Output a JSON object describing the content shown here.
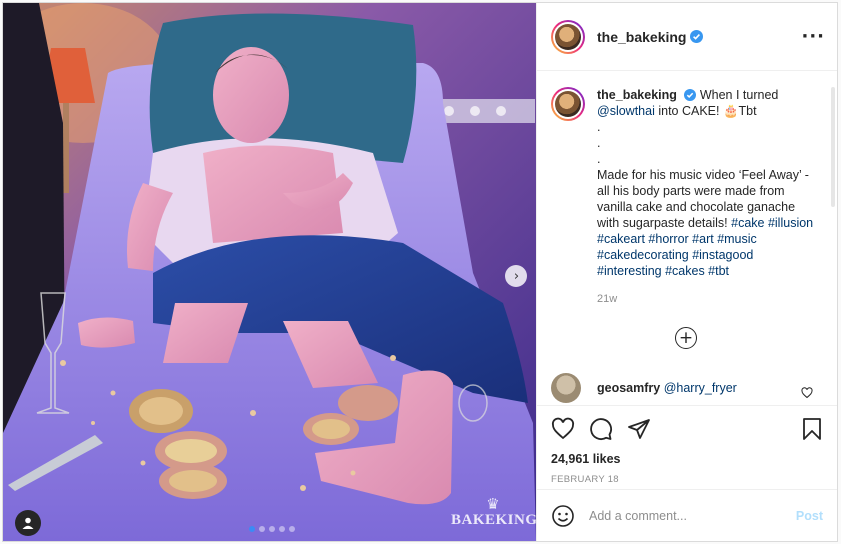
{
  "post": {
    "username": "the_bakeking",
    "verified": true,
    "more_icon": "more-horizontal-icon",
    "image": {
      "alt_icon": "photo",
      "watermark": "BAKEKING",
      "carousel_count": 5,
      "carousel_active": 0
    },
    "caption": {
      "username": "the_bakeking",
      "text_before_mention": "When I turned",
      "mention": "@slowthai",
      "text_after_mention": "into CAKE! 🎂Tbt",
      "dots": [
        ".",
        ".",
        "."
      ],
      "body": "Made for his music video ‘Feel Away’ - all his body parts were made from vanilla cake and chocolate ganache with sugarpaste details!",
      "hashtags": "#cake #illusion #cakeart #horror #art #music #cakedecorating #instagood #interesting #cakes #tbt",
      "time": "21w"
    },
    "comments": [
      {
        "username": "geosamfry",
        "mention": "@harry_fryer"
      }
    ],
    "likes": "24,961 likes",
    "date": "FEBRUARY 18",
    "add_comment_placeholder": "Add a comment...",
    "post_label": "Post",
    "colors": {
      "link": "#00376b",
      "post_button": "#b2dffc",
      "verified": "#3897f0",
      "muted": "#8e8e8e"
    }
  }
}
